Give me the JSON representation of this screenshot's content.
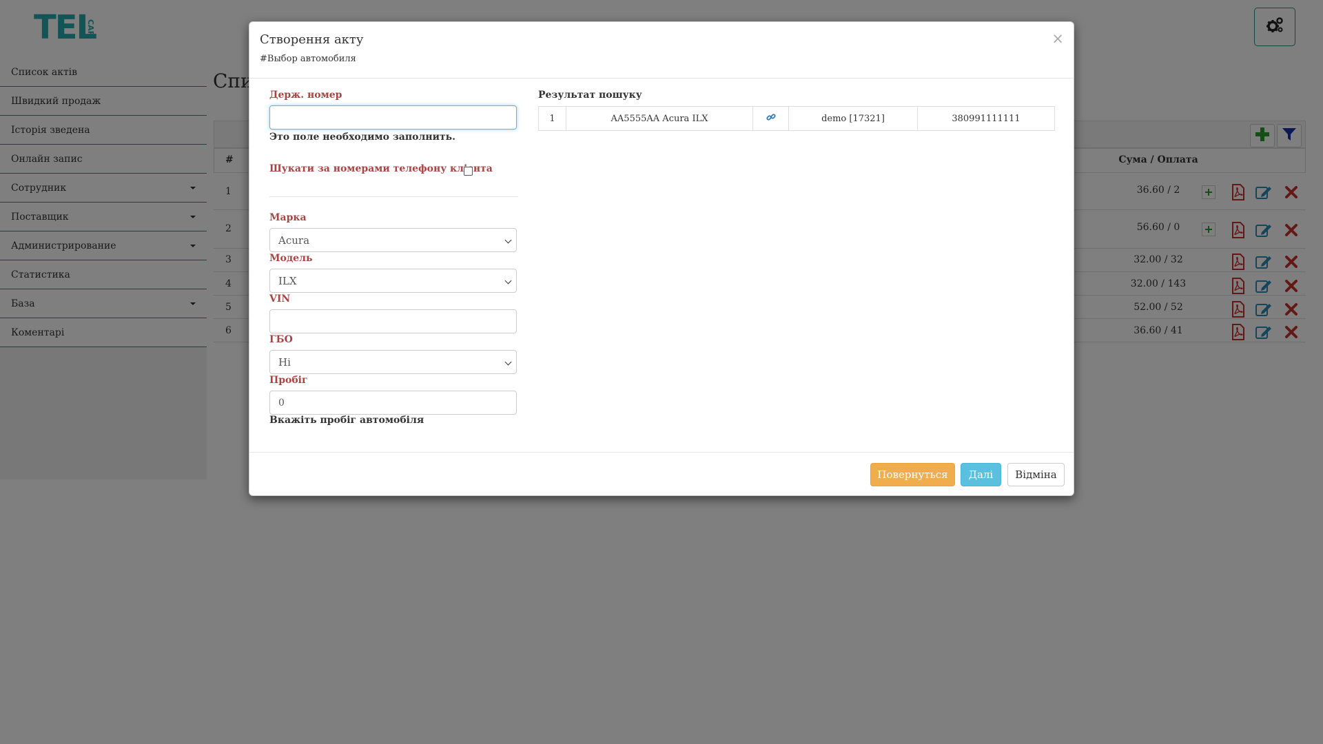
{
  "app": {
    "logo_main": "TEL",
    "logo_small": "CAR"
  },
  "sidebar": {
    "items": [
      {
        "label": "Список актів",
        "has_caret": false
      },
      {
        "label": "Швидкий продаж",
        "has_caret": false
      },
      {
        "label": "Історія зведена",
        "has_caret": false
      },
      {
        "label": "Онлайн запис",
        "has_caret": false
      },
      {
        "label": "Сотрудник",
        "has_caret": true
      },
      {
        "label": "Поставщик",
        "has_caret": true
      },
      {
        "label": "Администрирование",
        "has_caret": true
      },
      {
        "label": "Статистика",
        "has_caret": false
      },
      {
        "label": "База",
        "has_caret": true
      },
      {
        "label": "Коментарі",
        "has_caret": false
      }
    ]
  },
  "main": {
    "title": "Спи",
    "table": {
      "col_num": "#",
      "col_sum": "Сума / Оплата",
      "rows": [
        {
          "num": "1",
          "sum": "36.60 / 2"
        },
        {
          "num": "2",
          "sum": "56.60 / 0"
        },
        {
          "num": "3",
          "sum": "32.00 / 32"
        },
        {
          "num": "4",
          "sum": "32.00 / 143"
        },
        {
          "num": "5",
          "sum": "52.00 / 52"
        },
        {
          "num": "6",
          "sum": "36.60 / 41"
        }
      ]
    }
  },
  "modal": {
    "title": "Створення акту",
    "subtitle": "#Выбор автомобиля",
    "close": "×",
    "plate_label": "Держ. номер",
    "plate_value": "",
    "plate_error": "Это поле необходимо заполнить.",
    "phone_search_label": "Шукати за номерами телефону клієнта",
    "brand_label": "Марка",
    "brand_value": "Acura",
    "model_label": "Модель",
    "model_value": "ILX",
    "vin_label": "VIN",
    "vin_value": "",
    "gbo_label": "ГБО",
    "gbo_value": "Ні",
    "mileage_label": "Пробіг",
    "mileage_value": "0",
    "mileage_hint": "Вкажіть пробіг автомобіля",
    "result_title": "Результат пошуку",
    "result_row": {
      "num": "1",
      "car": "AA5555AA Acura ILX",
      "owner": "demo [17321]",
      "phone": "380991111111"
    },
    "btn_back": "Повернуться",
    "btn_next": "Далі",
    "btn_cancel": "Відміна"
  },
  "colors": {
    "brand": "#27a8ad",
    "label_red": "#a94442",
    "warning": "#f0ad4e",
    "info": "#5bc0de",
    "danger": "#c9302c",
    "add_green": "#2a9c2a",
    "filter_blue": "#1a2faa"
  }
}
